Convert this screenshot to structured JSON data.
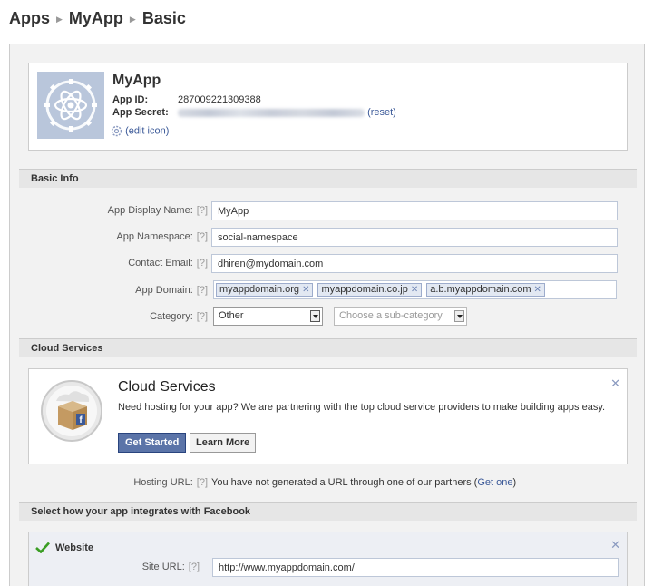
{
  "breadcrumb": [
    "Apps",
    "MyApp",
    "Basic"
  ],
  "app": {
    "name": "MyApp",
    "id_label": "App ID:",
    "id_value": "287009221309388",
    "secret_label": "App Secret:",
    "reset_link": "(reset)",
    "edit_icon_link": "(edit icon)"
  },
  "basic_info": {
    "title": "Basic Info",
    "help": "[?]",
    "display_name_label": "App Display Name:",
    "display_name_value": "MyApp",
    "namespace_label": "App Namespace:",
    "namespace_value": "social-namespace",
    "email_label": "Contact Email:",
    "email_value": "dhiren@mydomain.com",
    "domain_label": "App Domain:",
    "domains": [
      "myappdomain.org",
      "myappdomain.co.jp",
      "a.b.myappdomain.com"
    ],
    "category_label": "Category:",
    "category_value": "Other",
    "subcategory_placeholder": "Choose a sub-category"
  },
  "cloud": {
    "section_title": "Cloud Services",
    "card_title": "Cloud Services",
    "description": "Need hosting for your app? We are partnering with the top cloud service providers to make building apps easy.",
    "get_started": "Get Started",
    "learn_more": "Learn More",
    "hosting_label": "Hosting URL:",
    "hosting_text": "You have not generated a URL through one of our partners (",
    "get_one_link": "Get one",
    "hosting_text_end": ")"
  },
  "integration": {
    "section_title": "Select how your app integrates with Facebook",
    "website_label": "Website",
    "site_url_label": "Site URL:",
    "site_url_value": "http://www.myappdomain.com/"
  },
  "icons": {
    "close": "close-icon",
    "check": "checkmark-icon",
    "gear": "gear-icon",
    "atom": "atom-icon"
  },
  "colors": {
    "link": "#3b5998",
    "button_primary": "#5b74a8",
    "app_icon_bg": "#b9c6db",
    "check_green": "#3a9d23"
  }
}
